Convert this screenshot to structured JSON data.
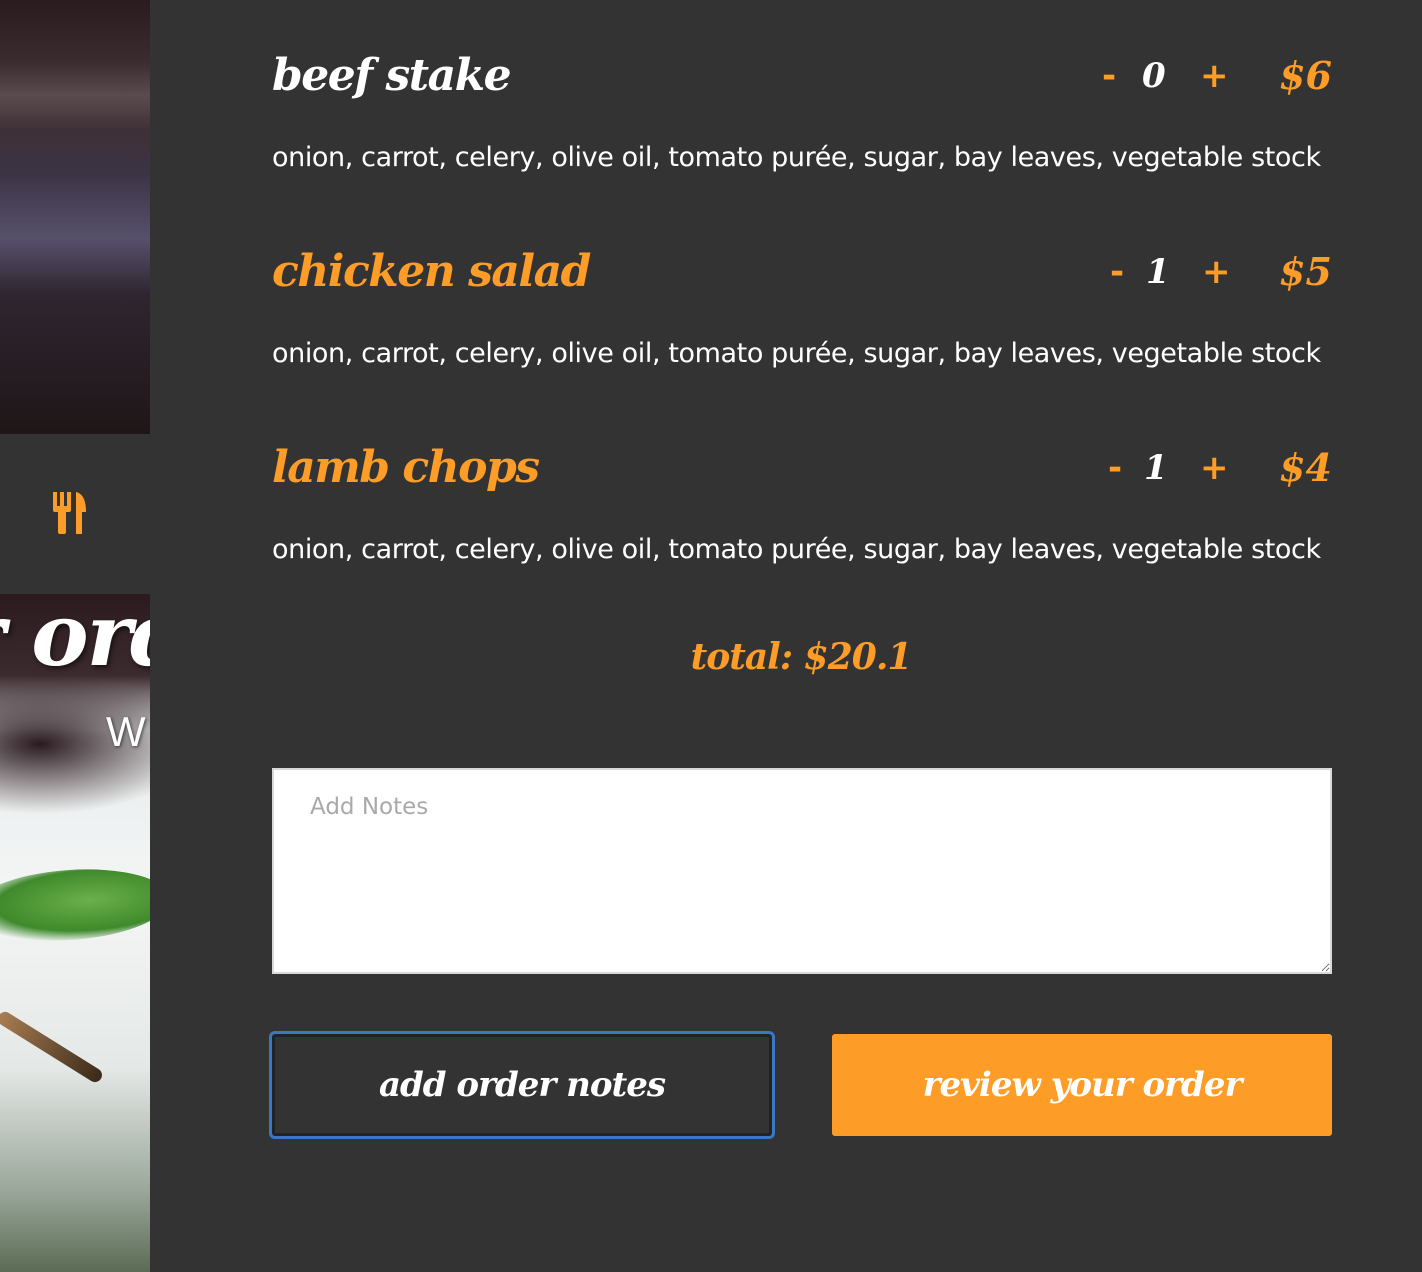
{
  "hero": {
    "title_fragment": "r ord",
    "subtitle_fragment": "W"
  },
  "nav": {
    "icon": "fork-knife-icon"
  },
  "items": [
    {
      "name": "beef stake",
      "quantity": "0",
      "minus": "-",
      "plus": "+",
      "price": "$6",
      "description": "onion, carrot, celery, olive oil, tomato purée, sugar, bay leaves, vegetable stock"
    },
    {
      "name": "chicken salad",
      "quantity": "1",
      "minus": "-",
      "plus": "+",
      "price": "$5",
      "description": "onion, carrot, celery, olive oil, tomato purée, sugar, bay leaves, vegetable stock"
    },
    {
      "name": "lamb chops",
      "quantity": "1",
      "minus": "-",
      "plus": "+",
      "price": "$4",
      "description": "onion, carrot, celery, olive oil, tomato purée, sugar, bay leaves, vegetable stock"
    }
  ],
  "total": "total: $20.1",
  "notes": {
    "placeholder": "Add Notes",
    "value": ""
  },
  "buttons": {
    "add_notes": "add order notes",
    "review": "review your order"
  },
  "colors": {
    "accent": "#fd9c27",
    "panel": "#333333",
    "focus": "#3b78c4"
  }
}
